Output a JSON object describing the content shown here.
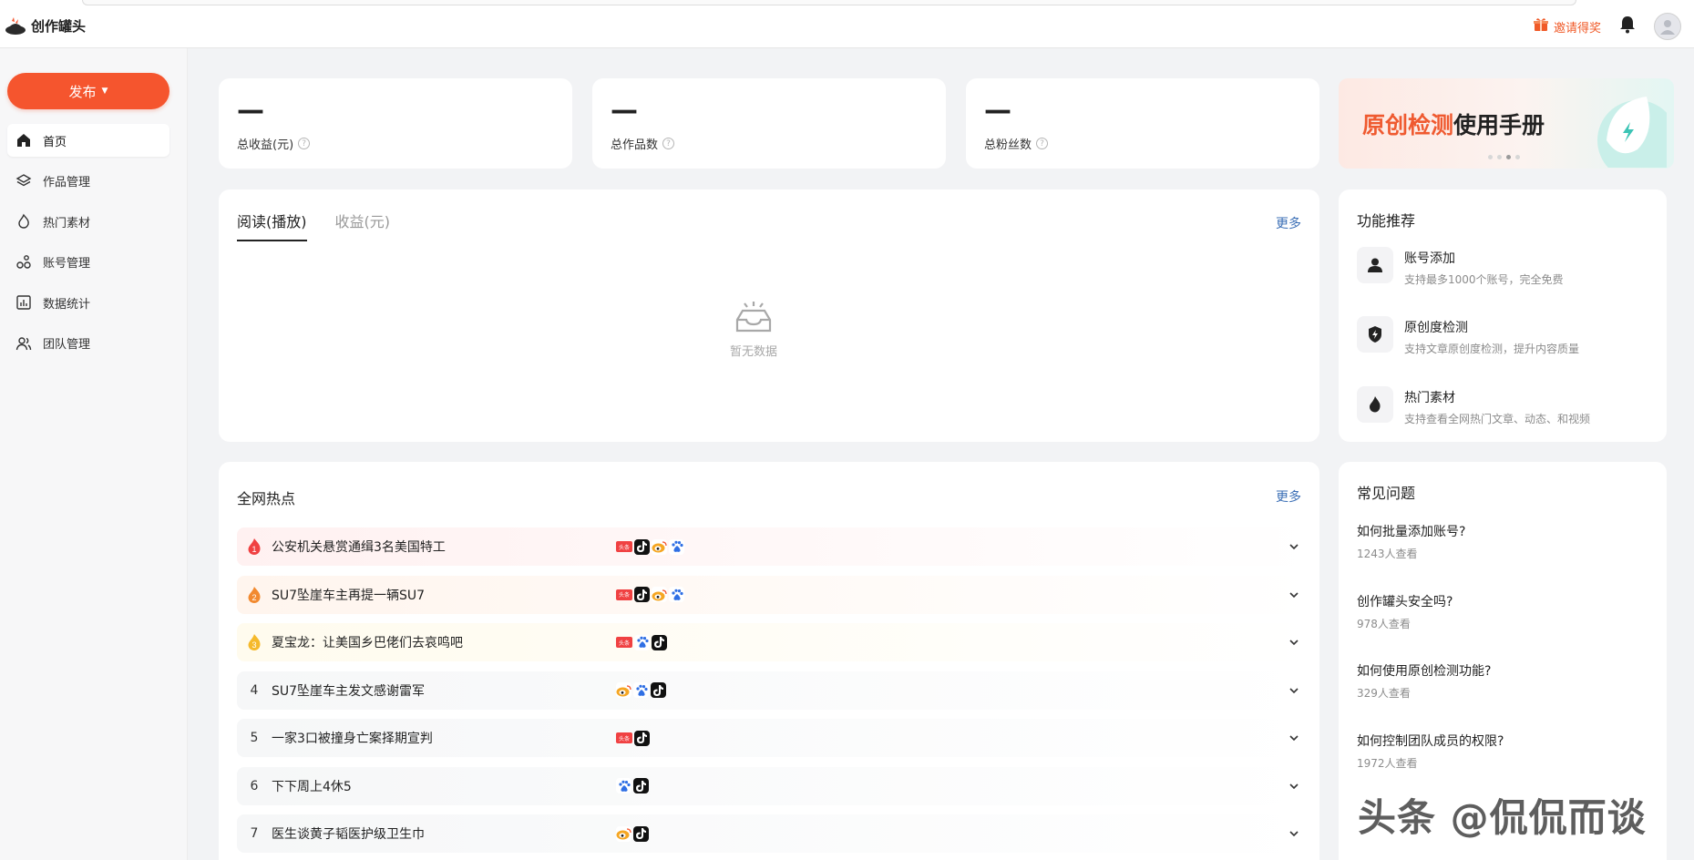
{
  "app": {
    "name": "创作罐头"
  },
  "header": {
    "invite_label": "邀请得奖"
  },
  "sidebar": {
    "publish_label": "发布",
    "items": [
      {
        "label": "首页",
        "icon": "home-icon"
      },
      {
        "label": "作品管理",
        "icon": "layers-icon"
      },
      {
        "label": "热门素材",
        "icon": "flame-icon"
      },
      {
        "label": "账号管理",
        "icon": "accounts-icon"
      },
      {
        "label": "数据统计",
        "icon": "chart-icon"
      },
      {
        "label": "团队管理",
        "icon": "team-icon"
      }
    ]
  },
  "stats": [
    {
      "value": "—",
      "label": "总收益(元)"
    },
    {
      "value": "—",
      "label": "总作品数"
    },
    {
      "value": "—",
      "label": "总粉丝数"
    }
  ],
  "banner": {
    "highlight": "原创检测",
    "rest": "使用手册"
  },
  "trend": {
    "tabs": [
      "阅读(播放)",
      "收益(元)"
    ],
    "more_label": "更多",
    "empty_text": "暂无数据"
  },
  "features": {
    "title": "功能推荐",
    "items": [
      {
        "title": "账号添加",
        "desc": "支持最多1000个账号，完全免费",
        "icon": "user-icon"
      },
      {
        "title": "原创度检测",
        "desc": "支持文章原创度检测，提升内容质量",
        "icon": "shield-bolt-icon"
      },
      {
        "title": "热门素材",
        "desc": "支持查看全网热门文章、动态、和视频",
        "icon": "flame-icon"
      }
    ]
  },
  "hot": {
    "title": "全网热点",
    "more_label": "更多",
    "rows": [
      {
        "rank": "1",
        "title": "公安机关悬赏通缉3名美国特工",
        "platforms": [
          "toutiao",
          "douyin",
          "weibo",
          "baidu"
        ],
        "bg": "#fff1f1",
        "rank_color": "#f04142"
      },
      {
        "rank": "2",
        "title": "SU7坠崖车主再提一辆SU7",
        "platforms": [
          "toutiao",
          "douyin",
          "weibo",
          "baidu"
        ],
        "bg": "#fff5ee",
        "rank_color": "#f28a30"
      },
      {
        "rank": "3",
        "title": "夏宝龙：让美国乡巴佬们去哀鸣吧",
        "platforms": [
          "toutiao",
          "baidu",
          "douyin"
        ],
        "bg": "#fffbee",
        "rank_color": "#f5b92b"
      },
      {
        "rank": "4",
        "title": "SU7坠崖车主发文感谢雷军",
        "platforms": [
          "weibo",
          "baidu",
          "douyin"
        ],
        "bg": "#f7f7f8",
        "rank_color": ""
      },
      {
        "rank": "5",
        "title": "一家3口被撞身亡案择期宣判",
        "platforms": [
          "toutiao",
          "douyin"
        ],
        "bg": "#f7f7f8",
        "rank_color": ""
      },
      {
        "rank": "6",
        "title": "下下周上4休5",
        "platforms": [
          "baidu",
          "douyin"
        ],
        "bg": "#f7f7f8",
        "rank_color": ""
      },
      {
        "rank": "7",
        "title": "医生谈黄子韬医护级卫生巾",
        "platforms": [
          "weibo",
          "douyin"
        ],
        "bg": "#f7f7f8",
        "rank_color": ""
      }
    ]
  },
  "faq": {
    "title": "常见问题",
    "items": [
      {
        "q": "如何批量添加账号?",
        "views": "1243人查看"
      },
      {
        "q": "创作罐头安全吗?",
        "views": "978人查看"
      },
      {
        "q": "如何使用原创检测功能?",
        "views": "329人查看"
      },
      {
        "q": "如何控制团队成员的权限?",
        "views": "1972人查看"
      }
    ]
  },
  "watermark": "头条 @侃侃而谈"
}
